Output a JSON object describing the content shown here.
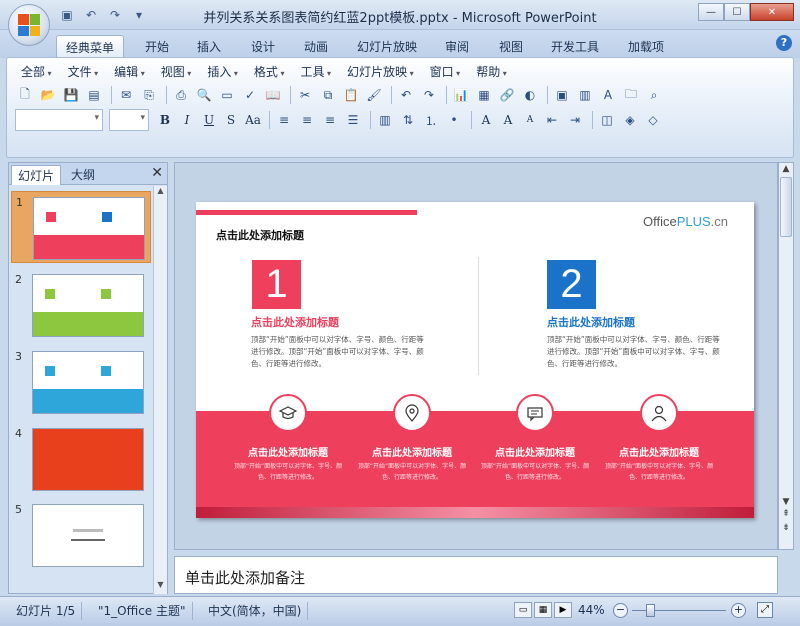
{
  "window": {
    "title": "并列关系关系图表简约红蓝2ppt模板.pptx - Microsoft PowerPoint"
  },
  "ribbon_tabs": [
    "经典菜单",
    "开始",
    "插入",
    "设计",
    "动画",
    "幻灯片放映",
    "审阅",
    "视图",
    "开发工具",
    "加载项"
  ],
  "menus": [
    "全部",
    "文件",
    "编辑",
    "视图",
    "插入",
    "格式",
    "工具",
    "幻灯片放映",
    "窗口",
    "帮助"
  ],
  "panel": {
    "tab_slides": "幻灯片",
    "tab_outline": "大纲",
    "close": "✕"
  },
  "thumbs": [
    {
      "num": "1",
      "accent": "#ee3f5c"
    },
    {
      "num": "2",
      "accent": "#8dc63f"
    },
    {
      "num": "3",
      "accent": "#2fa6d9"
    },
    {
      "num": "4",
      "accent": "#e8401c"
    },
    {
      "num": "5",
      "accent": "#ffffff"
    }
  ],
  "slide": {
    "title": "点击此处添加标题",
    "logo_office": "Office",
    "logo_plus": "PLUS",
    "logo_cn": ".cn",
    "num1": "1",
    "num2": "2",
    "col1_head": "点击此处添加标题",
    "col1_text": "顶部“开始”面板中可以对字体、字号、颜色、行距等进行修改。顶部“开始”面板中可以对字体、字号、颜色、行距等进行修改。",
    "col2_head": "点击此处添加标题",
    "col2_text": "顶部“开始”面板中可以对字体、字号、颜色、行距等进行修改。顶部“开始”面板中可以对字体、字号、颜色、行距等进行修改。",
    "bottom": [
      {
        "head": "点击此处添加标题",
        "text": "顶部“开始”面板中可以对字体、字号、颜色、行距等进行修改。",
        "icon": "graduation-cap-icon"
      },
      {
        "head": "点击此处添加标题",
        "text": "顶部“开始”面板中可以对字体、字号、颜色、行距等进行修改。",
        "icon": "map-pin-icon"
      },
      {
        "head": "点击此处添加标题",
        "text": "顶部“开始”面板中可以对字体、字号、颜色、行距等进行修改。",
        "icon": "chat-icon"
      },
      {
        "head": "点击此处添加标题",
        "text": "顶部“开始”面板中可以对字体、字号、颜色、行距等进行修改。",
        "icon": "user-icon"
      }
    ]
  },
  "notes": {
    "placeholder": "单击此处添加备注"
  },
  "status": {
    "slide": "幻灯片 1/5",
    "theme": "\"1_Office 主题\"",
    "lang": "中文(简体，中国)",
    "zoom": "44%"
  }
}
